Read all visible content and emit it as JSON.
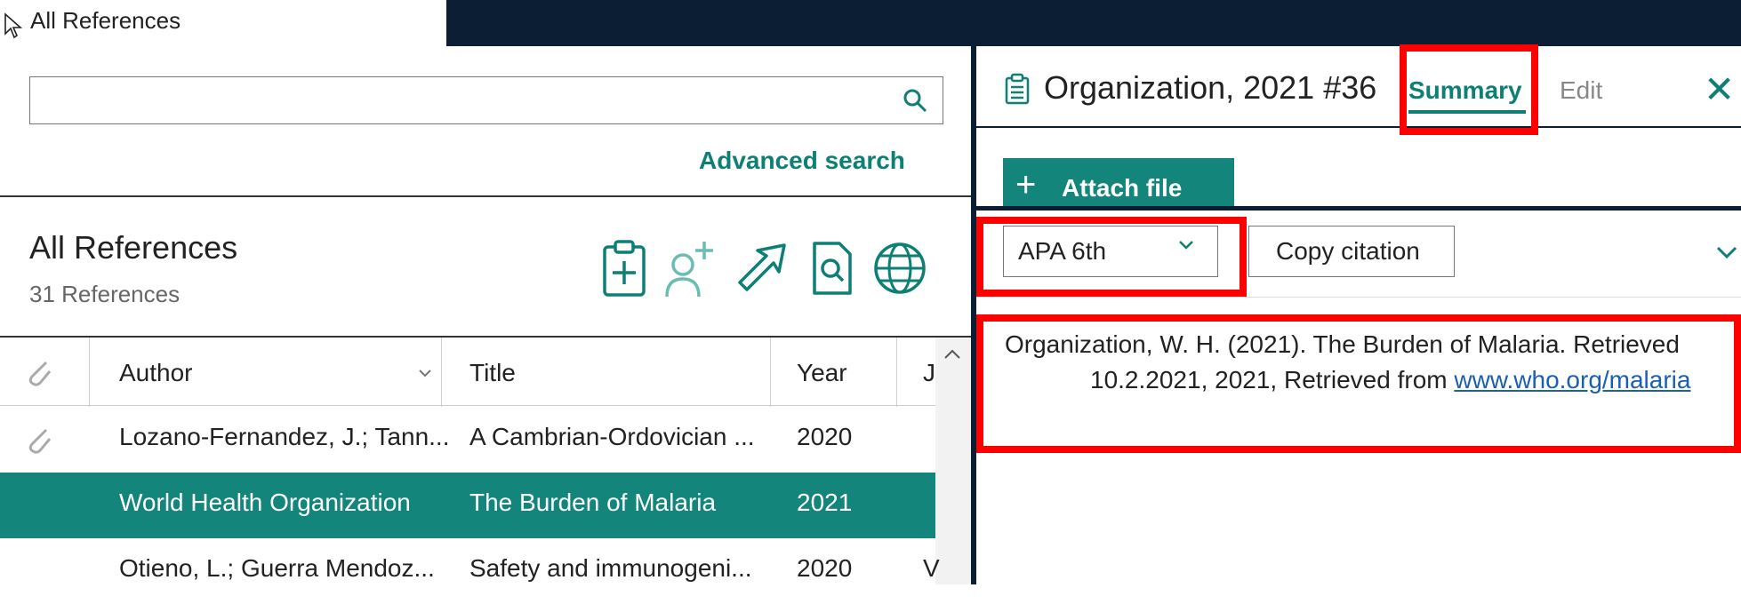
{
  "tab": {
    "label": "All References"
  },
  "search": {
    "value": "",
    "placeholder": "",
    "advanced_label": "Advanced search"
  },
  "library": {
    "title": "All References",
    "count": "31 References",
    "tools": [
      "new-reference-icon",
      "add-user-icon",
      "share-icon",
      "find-fulltext-icon",
      "web-icon"
    ]
  },
  "table": {
    "headers": {
      "author": "Author",
      "title": "Title",
      "year": "Year",
      "journal": "Jo"
    },
    "rows": [
      {
        "author": "Lozano-Fernandez, J.; Tann...",
        "title": "A Cambrian-Ordovician ...",
        "year": "2020",
        "journal": ""
      },
      {
        "author": "World Health Organization",
        "title": "The Burden of Malaria",
        "year": "2021",
        "journal": ""
      },
      {
        "author": "Otieno, L.; Guerra Mendoz...",
        "title": "Safety and immunogeni...",
        "year": "2020",
        "journal": "V"
      }
    ]
  },
  "detail": {
    "title": "Organization, 2021 #36",
    "tabs": {
      "summary": "Summary",
      "edit": "Edit"
    },
    "close": "✕",
    "attach_label": "Attach file",
    "style_value": "APA 6th",
    "copy_label": "Copy citation",
    "citation": {
      "line1": "Organization, W. H. (2021). The Burden of Malaria.   Retrieved",
      "line2": "10.2.2021, 2021, Retrieved  from ",
      "link": "www.who.org/malaria"
    }
  },
  "colors": {
    "accent": "#13857a",
    "dark": "#0b1e33",
    "highlight": "#ff0000"
  }
}
